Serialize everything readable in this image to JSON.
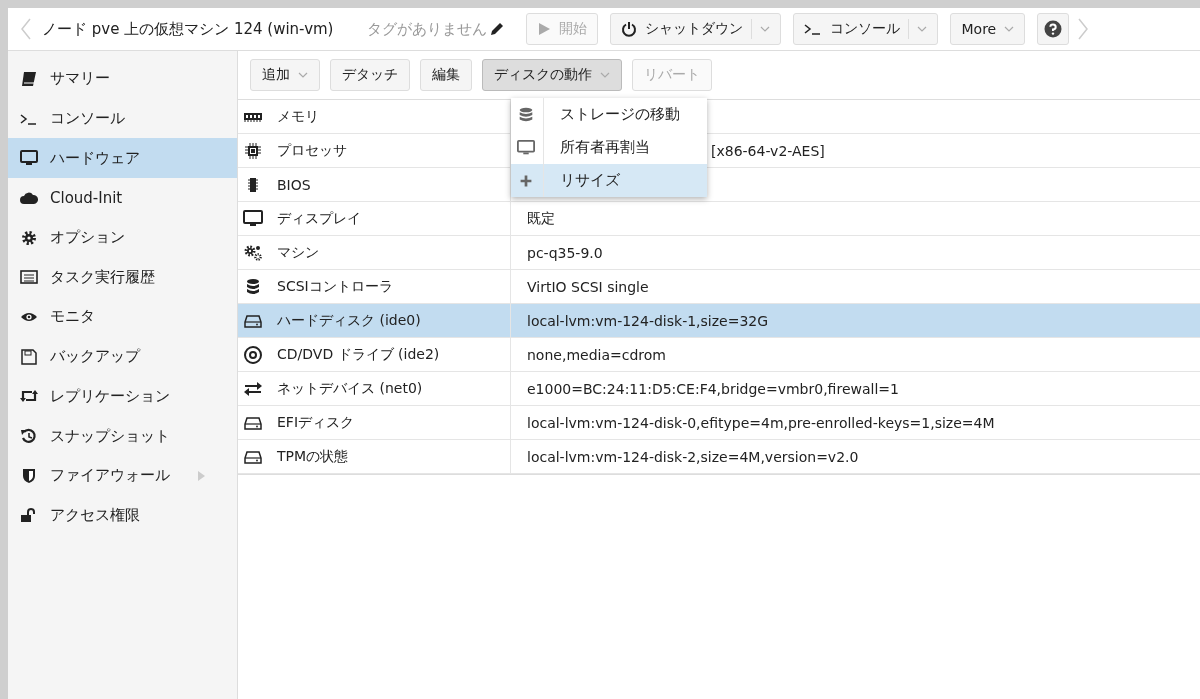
{
  "header": {
    "title": "ノード pve 上の仮想マシン 124 (win-vm)",
    "tags": "タグがありません",
    "buttons": [
      {
        "kind": "plain",
        "label": "開始",
        "disabled": true
      },
      {
        "kind": "split",
        "label": "シャットダウン",
        "disabled": false
      },
      {
        "kind": "split",
        "label": "コンソール",
        "disabled": false
      },
      {
        "kind": "menu",
        "label": "More",
        "disabled": false
      },
      {
        "kind": "help"
      }
    ]
  },
  "sidebar": {
    "items": [
      {
        "kind": "item",
        "label": "サマリー",
        "selected": false
      },
      {
        "kind": "item",
        "label": "コンソール",
        "selected": false
      },
      {
        "kind": "item",
        "label": "ハードウェア",
        "selected": true
      },
      {
        "kind": "item",
        "label": "Cloud-Init",
        "selected": false
      },
      {
        "kind": "item",
        "label": "オプション",
        "selected": false
      },
      {
        "kind": "item",
        "label": "タスク実行履歴",
        "selected": false
      },
      {
        "kind": "item",
        "label": "モニタ",
        "selected": false
      },
      {
        "kind": "item",
        "label": "バックアップ",
        "selected": false
      },
      {
        "kind": "item",
        "label": "レプリケーション",
        "selected": false
      },
      {
        "kind": "item",
        "label": "スナップショット",
        "selected": false
      },
      {
        "kind": "group",
        "label": "ファイアウォール",
        "selected": false
      },
      {
        "kind": "item",
        "label": "アクセス権限",
        "selected": false
      }
    ]
  },
  "toolbar": [
    {
      "kind": "dropdown",
      "label": "追加",
      "disabled": false,
      "pressed": false
    },
    {
      "kind": "plain",
      "label": "デタッチ",
      "disabled": false,
      "pressed": false
    },
    {
      "kind": "plain",
      "label": "編集",
      "disabled": false,
      "pressed": false
    },
    {
      "kind": "dropdown",
      "label": "ディスクの動作",
      "disabled": false,
      "pressed": true
    },
    {
      "kind": "plain",
      "label": "リバート",
      "disabled": true,
      "pressed": false
    }
  ],
  "menu": [
    {
      "label": "ストレージの移動",
      "selected": false
    },
    {
      "label": "所有者再割当",
      "selected": false
    },
    {
      "label": "リサイズ",
      "selected": true
    }
  ],
  "table": {
    "rows": [
      {
        "kind": "plain",
        "name": "メモリ",
        "selected": false
      },
      {
        "kind": "under-menu",
        "name": "プロセッサ",
        "value": "[x86-64-v2-AES]",
        "selected": false
      },
      {
        "kind": "plain",
        "name": "BIOS",
        "selected": false
      },
      {
        "kind": "plain",
        "name": "ディスプレイ",
        "value": "既定",
        "selected": false
      },
      {
        "kind": "plain",
        "name": "マシン",
        "value": "pc-q35-9.0",
        "selected": false
      },
      {
        "kind": "plain",
        "name": "SCSIコントローラ",
        "value": "VirtIO SCSI single",
        "selected": false
      },
      {
        "kind": "plain",
        "name": "ハードディスク (ide0)",
        "value": "local-lvm:vm-124-disk-1,size=32G",
        "selected": true
      },
      {
        "kind": "plain",
        "name": "CD/DVD ドライブ (ide2)",
        "value": "none,media=cdrom",
        "selected": false
      },
      {
        "kind": "plain",
        "name": "ネットデバイス (net0)",
        "value": "e1000=BC:24:11:D5:CE:F4,bridge=vmbr0,firewall=1",
        "selected": false
      },
      {
        "kind": "plain",
        "name": "EFIディスク",
        "value": "local-lvm:vm-124-disk-0,efitype=4m,pre-enrolled-keys=1,size=4M",
        "selected": false
      },
      {
        "kind": "plain",
        "name": "TPMの状態",
        "value": "local-lvm:vm-124-disk-2,size=4M,version=v2.0",
        "selected": false
      }
    ]
  }
}
